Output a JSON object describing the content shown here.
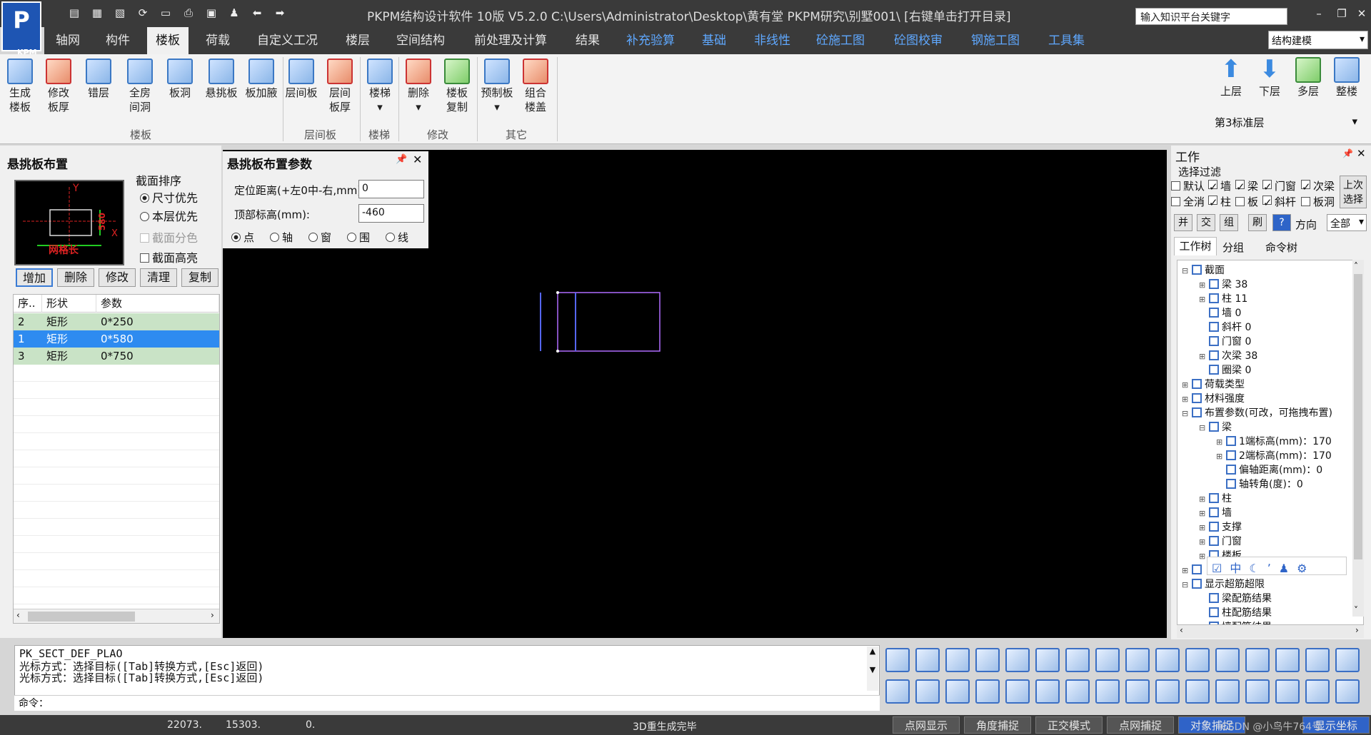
{
  "app": {
    "title": "PKPM结构设计软件 10版 V5.2.0 C:\\Users\\Administrator\\Desktop\\黄有堂 PKPM研究\\别墅001\\  [右键单击打开目录]",
    "logo": "P",
    "logo_sub": "KPM",
    "search_placeholder": "输入知识平台关键字",
    "mode": "结构建模"
  },
  "menu": [
    "轴网",
    "构件",
    "楼板",
    "荷载",
    "自定义工况",
    "楼层",
    "空间结构",
    "前处理及计算",
    "结果",
    "补充验算",
    "基础",
    "非线性",
    "砼施工图",
    "砼图校审",
    "钢施工图",
    "工具集"
  ],
  "ribbon": {
    "buttons": [
      {
        "l1": "生成",
        "l2": "楼板"
      },
      {
        "l1": "修改",
        "l2": "板厚"
      },
      {
        "l1": "错层",
        "l2": ""
      },
      {
        "l1": "全房",
        "l2": "间洞"
      },
      {
        "l1": "板洞",
        "l2": ""
      },
      {
        "l1": "悬挑板",
        "l2": ""
      },
      {
        "l1": "板加腋",
        "l2": ""
      },
      {
        "l1": "层间板",
        "l2": ""
      },
      {
        "l1": "层间",
        "l2": "板厚"
      },
      {
        "l1": "楼梯",
        "l2": ""
      },
      {
        "l1": "删除",
        "l2": ""
      },
      {
        "l1": "楼板",
        "l2": "复制"
      },
      {
        "l1": "预制板",
        "l2": ""
      },
      {
        "l1": "组合",
        "l2": "楼盖"
      }
    ],
    "groups": [
      "楼板",
      "层间板",
      "楼梯",
      "修改",
      "其它"
    ],
    "right_buttons": [
      "上层",
      "下层",
      "多层",
      "整楼"
    ],
    "floor": "第3标准层"
  },
  "left_panel": {
    "title": "悬挑板布置",
    "preview_dim": "580",
    "preview_label": "网格长",
    "preview_axes": [
      "Y",
      "X"
    ],
    "sort_title": "截面排序",
    "sort_options": [
      "尺寸优先",
      "本层优先"
    ],
    "color_by_section": "截面分色",
    "section_height": "截面高亮",
    "buttons": [
      "增加",
      "删除",
      "修改",
      "清理",
      "复制"
    ],
    "table": {
      "headers": [
        "序..",
        "形状",
        "参数"
      ],
      "rows": [
        {
          "no": "2",
          "shape": "矩形",
          "param": "0*250"
        },
        {
          "no": "1",
          "shape": "矩形",
          "param": "0*580"
        },
        {
          "no": "3",
          "shape": "矩形",
          "param": "0*750"
        }
      ]
    }
  },
  "params": {
    "title": "悬挑板布置参数",
    "offset_label": "定位距离(+左0中-右,mm):",
    "offset_value": "0",
    "top_label": "顶部标高(mm):",
    "top_value": "-460",
    "modes": [
      "点",
      "轴",
      "窗",
      "围",
      "线"
    ]
  },
  "right_panel": {
    "title": "工作",
    "filter_title": "选择过滤",
    "filter_row1": [
      "默认",
      "墙",
      "梁",
      "门窗",
      "次梁"
    ],
    "filter_row2": [
      "全消",
      "柱",
      "板",
      "斜杆",
      "板洞"
    ],
    "last_select": "上次选择",
    "tools": [
      "并",
      "交",
      "组",
      "刷"
    ],
    "dir_label": "方向",
    "dir_value": "全部",
    "tabs": [
      "工作树",
      "分组",
      "命令树"
    ],
    "tree": [
      {
        "t": "截面",
        "lv": 0,
        "pm": "−"
      },
      {
        "t": "梁 38",
        "lv": 1,
        "pm": "+"
      },
      {
        "t": "柱 11",
        "lv": 1,
        "pm": "+"
      },
      {
        "t": "墙 0",
        "lv": 1,
        "pm": ""
      },
      {
        "t": "斜杆 0",
        "lv": 1,
        "pm": ""
      },
      {
        "t": "门窗 0",
        "lv": 1,
        "pm": ""
      },
      {
        "t": "次梁 38",
        "lv": 1,
        "pm": "+"
      },
      {
        "t": "圈梁 0",
        "lv": 1,
        "pm": ""
      },
      {
        "t": "荷载类型",
        "lv": 0,
        "pm": "+"
      },
      {
        "t": "材料强度",
        "lv": 0,
        "pm": "+"
      },
      {
        "t": "布置参数(可改，可拖拽布置)",
        "lv": 0,
        "pm": "−"
      },
      {
        "t": "梁",
        "lv": 1,
        "pm": "−"
      },
      {
        "t": "1端标高(mm)：170",
        "lv": 2,
        "pm": "+"
      },
      {
        "t": "2端标高(mm)：170",
        "lv": 2,
        "pm": "+"
      },
      {
        "t": "偏轴距离(mm)：0",
        "lv": 2,
        "pm": ""
      },
      {
        "t": "轴转角(度)：0",
        "lv": 2,
        "pm": ""
      },
      {
        "t": "柱",
        "lv": 1,
        "pm": "+"
      },
      {
        "t": "墙",
        "lv": 1,
        "pm": "+"
      },
      {
        "t": "支撑",
        "lv": 1,
        "pm": "+"
      },
      {
        "t": "门窗",
        "lv": 1,
        "pm": "+"
      },
      {
        "t": "楼板",
        "lv": 1,
        "pm": "+"
      },
      {
        "t": "",
        "lv": 0,
        "pm": "+"
      },
      {
        "t": "显示超筋超限",
        "lv": 0,
        "pm": "−"
      },
      {
        "t": "梁配筋结果",
        "lv": 1,
        "pm": ""
      },
      {
        "t": "柱配筋结果",
        "lv": 1,
        "pm": ""
      },
      {
        "t": "墙配筋结果",
        "lv": 1,
        "pm": ""
      }
    ]
  },
  "command": {
    "lines": [
      "PK_SECT_DEF_PLAO",
      "光标方式：选择目标([Tab]转换方式,[Esc]返回)",
      "光标方式：选择目标([Tab]转换方式,[Esc]返回)"
    ],
    "prompt": "命令："
  },
  "status": {
    "x": "22073.",
    "y": "15303.",
    "z": "0.",
    "message": "3D重生成完毕",
    "toggles": [
      "点网显示",
      "角度捕捉",
      "正交模式",
      "点网捕捉",
      "对象捕捉",
      "显示坐标"
    ],
    "watermark": "CSDN @小鸟牛764号"
  }
}
